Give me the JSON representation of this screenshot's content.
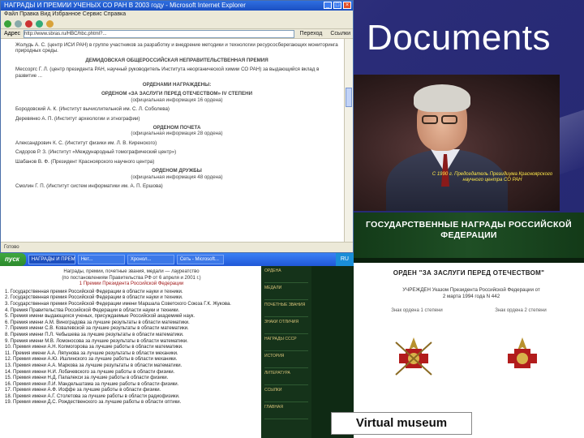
{
  "slide": {
    "title": "Documents",
    "museum_label": "Virtual museum"
  },
  "browser1": {
    "title": "НАГРАДЫ И ПРЕМИИ УЧЕНЫХ СО РАН В 2003 году - Microsoft Internet Explorer",
    "menu": "Файл  Правка  Вид  Избранное  Сервис  Справка",
    "address_label": "Адрес",
    "address": "http://www.sbras.ru/HBC/hbc.phtml?...",
    "go_label": "Переход",
    "links_label": "Ссылки",
    "paragraphs": [
      "Жолудь А. С. (центр ИСИ РАН) в группе участников за разработку и внедрение методики и технологии ресурсосберегающих мониторинга природных среды.",
      "ДЕМИДОВСКАЯ ОБЩЕРОССИЙСКАЯ НЕПРАВИТЕЛЬСТВЕННАЯ ПРЕМИЯ",
      "Мессоргс Г. Л. (центр президента РАН, научный руководитель Института неорганической химии СО РАН) за выдающийся вклад в развитие ...",
      "ОРДЕНАМИ НАГРАЖДЕНЫ:",
      "ОРДЕНОМ «ЗА ЗАСЛУГИ ПЕРЕД ОТЕЧЕСТВОМ» IV СТЕПЕНИ",
      "(официальная информация 16 ордена)",
      "Бородовский А. К. (Институт вычислительной им. С. Л. Соболева)",
      "Деревянко А. П. (Институт археологии и этнографии)",
      "ОРДЕНОМ ПОЧЕТА",
      "(официальная информация 28 ордена)",
      "Александрович К. С. (Институт физики им. Л. В. Киренского)",
      "Сидоров Р. З. (Институт «Международный томографический центр»)",
      "Шабанов В. Ф. (Президент Красноярского научного центра)",
      "ОРДЕНОМ ДРУЖБЫ",
      "(официальная информация 48 ордена)",
      "Смолин Г. П. (Институт систем информатики им. А. П. Ершова)"
    ],
    "status": "Готово"
  },
  "taskbar": {
    "start_label": "пуск",
    "tasks": [
      "НАГРАДЫ И ПРЕМИИ...",
      "Нет...",
      "Хронол...",
      "Сеть - Microsoft...",
      "Microsoft Power..."
    ],
    "tray": "RU"
  },
  "photo": {
    "caption": "С 1990 г. Председатель Президиума Красноярского научного центра СО РАН"
  },
  "browser2": {
    "header_lines": [
      "Награды, премии, почетные звания, медали — лауреатство",
      "(по постановлениям Правительства РФ от 6 апреля и 2001 г.)",
      "1 Премии Президента Российской Федерации"
    ],
    "items": [
      "1. Государственная премия Российской Федерации в области науки и техники.",
      "2. Государственная премия Российской Федерации в области науки и техники.",
      "3. Государственная премия Российской Федерации имени Маршала Советского Союза Г.К. Жукова.",
      "4. Премия Правительства Российской Федерации в области науки и техники.",
      "5. Премия имени выдающихся ученых, присуждаемые Российской академией наук.",
      "6. Премия имени А.М. Виноградова за лучшие результаты в области математики.",
      "7. Премия имени С.В. Ковалевской за лучшие результаты в области математики.",
      "8. Премия имени П.Л. Чебышева за лучшие результаты в области математики.",
      "9. Премия имени М.В. Ломоносова за лучшие результаты в области математики.",
      "10. Премия имени А.Н. Колмогорова за лучшие работы в области математики.",
      "11. Премия имени А.А. Ляпунова за лучшие результаты в области механики.",
      "12. Премия имени А.Ю. Ишлинского за лучшие работы в области механики.",
      "13. Премия имени А.А. Маркова за лучшие результаты в области математики.",
      "14. Премия имени Н.И. Лобачевского за лучшие работы в области физики.",
      "15. Премия имени Н.Д. Папалекси за лучшие работы в области физики.",
      "16. Премия имени Л.И. Мандельштама за лучшие работы в области физики.",
      "17. Премия имени А.Ф. Иоффе за лучшие работы в области физики.",
      "18. Премия имени А.Г. Столетова за лучшие работы в области радиофизики.",
      "19. Премия имени Д.С. Рождественского за лучшие работы в области оптики."
    ],
    "nav_items": [
      "ОРДЕНА",
      "МЕДАЛИ",
      "ПОЧЕТНЫЕ ЗВАНИЯ",
      "ЗНАКИ ОТЛИЧИЯ",
      "НАГРАДЫ СССР",
      "ИСТОРИЯ",
      "ЛИТЕРАТУРА",
      "ССЫЛКИ",
      "ГЛАВНАЯ"
    ]
  },
  "awards": {
    "head": "ГОСУДАРСТВЕННЫЕ НАГРАДЫ РОССИЙСКОЙ ФЕДЕРАЦИИ",
    "order_title": "ОРДЕН \"ЗА ЗАСЛУГИ ПЕРЕД ОТЕЧЕСТВОМ\"",
    "decree": "УЧРЕЖДЕН Указом Президента Российской Федерации от 2 марта 1994 года N 442",
    "degree_left": "Знак ордена 1 степени",
    "degree_right": "Знак ордена 2 степени"
  }
}
